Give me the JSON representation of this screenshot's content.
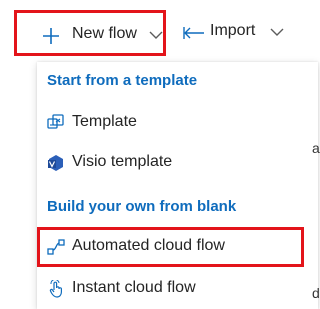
{
  "toolbar": {
    "new_flow_label": "New flow",
    "import_label": "Import"
  },
  "menu": {
    "sections": [
      {
        "header": "Start from a template",
        "items": [
          {
            "label": "Template",
            "icon": "template-icon"
          },
          {
            "label": "Visio template",
            "icon": "visio-icon"
          }
        ]
      },
      {
        "header": "Build your own from blank",
        "items": [
          {
            "label": "Automated cloud flow",
            "icon": "automated-flow-icon"
          },
          {
            "label": "Instant cloud flow",
            "icon": "instant-flow-icon"
          }
        ]
      }
    ]
  },
  "colors": {
    "accent": "#0f6cbd",
    "highlight_border": "#e3141a",
    "text": "#242424"
  }
}
